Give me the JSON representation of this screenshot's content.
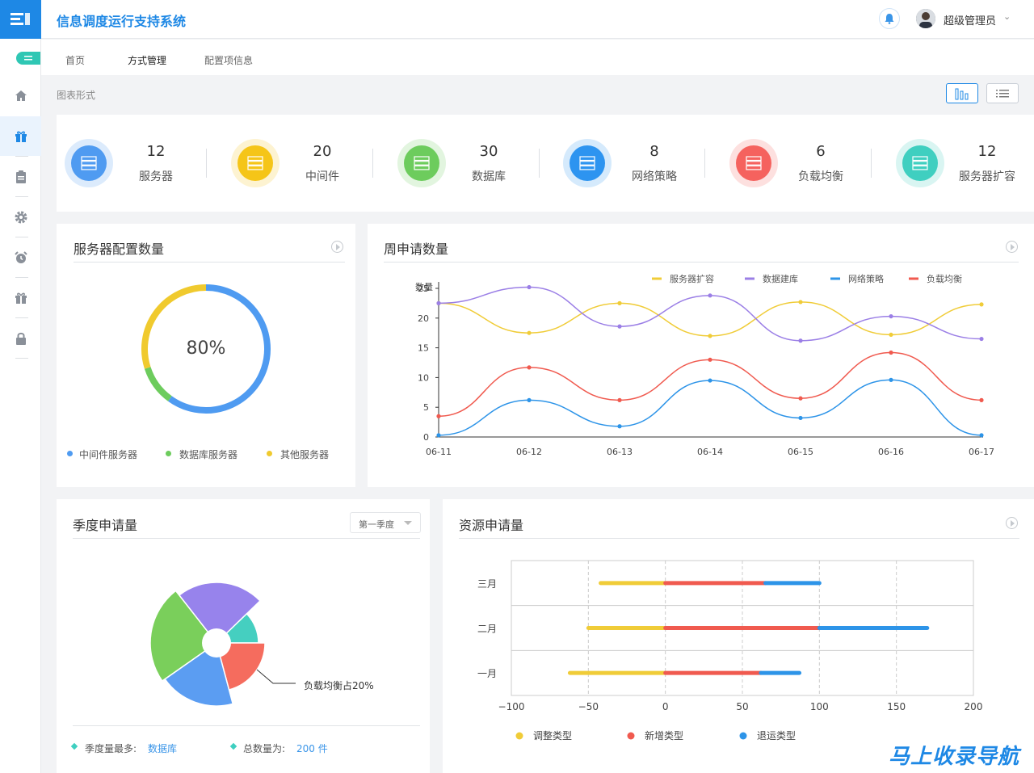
{
  "app": {
    "title": "信息调度运行支持系统",
    "user": "超级管理员"
  },
  "tabs": [
    {
      "label": "首页"
    },
    {
      "label": "方式管理"
    },
    {
      "label": "配置项信息"
    }
  ],
  "breadcrumb": "图表形式",
  "sidebar": {
    "items": [
      "home-icon",
      "gift-icon",
      "clipboard-icon",
      "gear-icon",
      "alarm-icon",
      "gift-box-icon",
      "lock-icon"
    ]
  },
  "stats": [
    {
      "value": "12",
      "label": "服务器",
      "color": "#4f9bf1"
    },
    {
      "value": "20",
      "label": "中间件",
      "color": "#f5c518"
    },
    {
      "value": "30",
      "label": "数据库",
      "color": "#6dcc5d"
    },
    {
      "value": "8",
      "label": "网络策略",
      "color": "#2d94f0"
    },
    {
      "value": "6",
      "label": "负载均衡",
      "color": "#f5625e"
    },
    {
      "value": "12",
      "label": "服务器扩容",
      "color": "#3fcfc0"
    }
  ],
  "server_panel": {
    "title": "服务器配置数量",
    "center": "80%",
    "legend": [
      {
        "label": "中间件服务器",
        "color": "#4f9bf1"
      },
      {
        "label": "数据库服务器",
        "color": "#6dcc5d"
      },
      {
        "label": "其他服务器",
        "color": "#f0ca2e"
      }
    ]
  },
  "weekly_panel": {
    "title": "周申请数量"
  },
  "season_panel": {
    "title": "季度申请量",
    "select": "第一季度",
    "annotation": "负载均衡占20%",
    "footer": {
      "most_label": "季度量最多:",
      "most_value": "数据库",
      "total_label": "总数量为:",
      "total_value": "200 件"
    }
  },
  "resource_panel": {
    "title": "资源申请量"
  },
  "watermark": "马上收录导航",
  "chart_data": [
    {
      "type": "pie",
      "title": "服务器配置数量",
      "center_label": "80%",
      "series": [
        {
          "name": "中间件服务器",
          "values": [
            60
          ]
        },
        {
          "name": "数据库服务器",
          "values": [
            10
          ]
        },
        {
          "name": "其他服务器",
          "values": [
            30
          ]
        }
      ]
    },
    {
      "type": "line",
      "title": "周申请数量",
      "ylabel": "数量",
      "ylim": [
        0,
        25
      ],
      "categories": [
        "06-11",
        "06-12",
        "06-13",
        "06-14",
        "06-15",
        "06-16",
        "06-17"
      ],
      "yticks": [
        0,
        5,
        10,
        15,
        20,
        25
      ],
      "series": [
        {
          "name": "服务器扩容",
          "color": "#f0cc38",
          "values": [
            22.5,
            17.5,
            22.5,
            17,
            22.7,
            17.2,
            22.3
          ]
        },
        {
          "name": "数据建库",
          "color": "#9b7fe6",
          "values": [
            22.5,
            25.2,
            18.6,
            23.8,
            16.2,
            20.3,
            16.5
          ]
        },
        {
          "name": "网络策略",
          "color": "#2d94e8",
          "values": [
            0.3,
            6.2,
            1.8,
            9.5,
            3.2,
            9.6,
            0.3
          ]
        },
        {
          "name": "负载均衡",
          "color": "#f05a4f",
          "values": [
            3.5,
            11.7,
            6.2,
            13.0,
            6.5,
            14.2,
            6.2
          ]
        }
      ]
    },
    {
      "type": "pie",
      "title": "季度申请量",
      "series": [
        {
          "name": "负载均衡",
          "values": [
            20
          ]
        }
      ]
    },
    {
      "type": "bar",
      "title": "资源申请量",
      "orientation": "horizontal",
      "stacked": true,
      "categories": [
        "一月",
        "二月",
        "三月"
      ],
      "xlim": [
        -100,
        200
      ],
      "xticks": [
        -100,
        -50,
        0,
        50,
        100,
        150,
        200
      ],
      "series": [
        {
          "name": "调整类型",
          "color": "#f0cc38",
          "values": [
            -62,
            -50,
            -42
          ]
        },
        {
          "name": "新增类型",
          "color": "#f05a4f",
          "values": [
            62,
            100,
            65
          ]
        },
        {
          "name": "退运类型",
          "color": "#2d94e8",
          "values": [
            25,
            70,
            35
          ]
        }
      ]
    }
  ]
}
